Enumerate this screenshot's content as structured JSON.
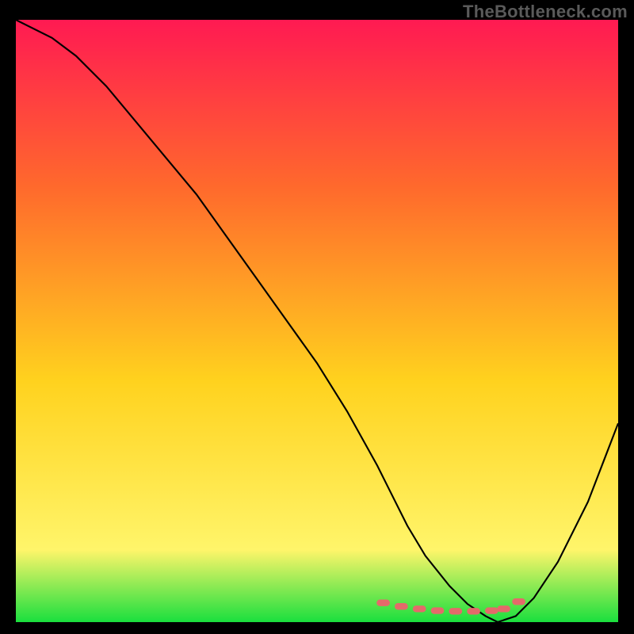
{
  "watermark": "TheBottleneck.com",
  "colors": {
    "gradient_top": "#ff1a52",
    "gradient_mid_upper": "#ff6a2c",
    "gradient_mid": "#ffd21e",
    "gradient_lower": "#fff56a",
    "gradient_bottom": "#1adf3e",
    "curve": "#000000",
    "marker": "#e46a6a",
    "frame": "#000000"
  },
  "chart_data": {
    "type": "line",
    "title": "",
    "xlabel": "",
    "ylabel": "",
    "ylim": [
      0,
      100
    ],
    "xlim": [
      0,
      100
    ],
    "series": [
      {
        "name": "bottleneck-curve",
        "x": [
          0,
          6,
          10,
          15,
          20,
          25,
          30,
          35,
          40,
          45,
          50,
          55,
          60,
          62,
          65,
          68,
          72,
          75,
          78,
          80,
          83,
          86,
          90,
          95,
          100
        ],
        "values": [
          100,
          97,
          94,
          89,
          83,
          77,
          71,
          64,
          57,
          50,
          43,
          35,
          26,
          22,
          16,
          11,
          6,
          3,
          1,
          0,
          1,
          4,
          10,
          20,
          33
        ]
      }
    ],
    "markers": {
      "name": "optimal-range-dots",
      "x": [
        61,
        64,
        67,
        70,
        73,
        76,
        79,
        81,
        83.5
      ],
      "values": [
        3.2,
        2.6,
        2.2,
        1.9,
        1.8,
        1.8,
        1.9,
        2.2,
        3.4
      ]
    }
  }
}
